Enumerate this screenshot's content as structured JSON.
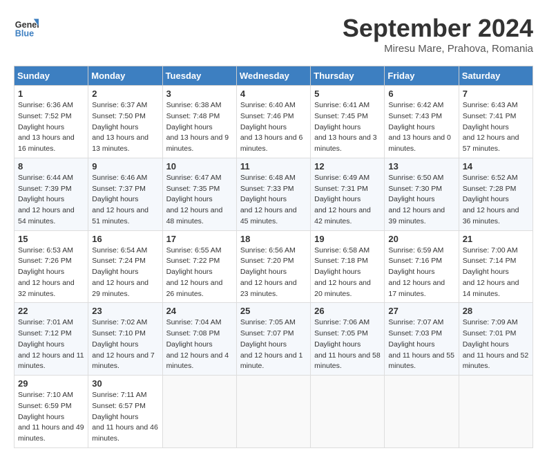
{
  "logo": {
    "line1": "General",
    "line2": "Blue"
  },
  "title": "September 2024",
  "location": "Miresu Mare, Prahova, Romania",
  "days_of_week": [
    "Sunday",
    "Monday",
    "Tuesday",
    "Wednesday",
    "Thursday",
    "Friday",
    "Saturday"
  ],
  "weeks": [
    [
      {
        "day": "1",
        "sunrise": "6:36 AM",
        "sunset": "7:52 PM",
        "daylight": "13 hours and 16 minutes."
      },
      {
        "day": "2",
        "sunrise": "6:37 AM",
        "sunset": "7:50 PM",
        "daylight": "13 hours and 13 minutes."
      },
      {
        "day": "3",
        "sunrise": "6:38 AM",
        "sunset": "7:48 PM",
        "daylight": "13 hours and 9 minutes."
      },
      {
        "day": "4",
        "sunrise": "6:40 AM",
        "sunset": "7:46 PM",
        "daylight": "13 hours and 6 minutes."
      },
      {
        "day": "5",
        "sunrise": "6:41 AM",
        "sunset": "7:45 PM",
        "daylight": "13 hours and 3 minutes."
      },
      {
        "day": "6",
        "sunrise": "6:42 AM",
        "sunset": "7:43 PM",
        "daylight": "13 hours and 0 minutes."
      },
      {
        "day": "7",
        "sunrise": "6:43 AM",
        "sunset": "7:41 PM",
        "daylight": "12 hours and 57 minutes."
      }
    ],
    [
      {
        "day": "8",
        "sunrise": "6:44 AM",
        "sunset": "7:39 PM",
        "daylight": "12 hours and 54 minutes."
      },
      {
        "day": "9",
        "sunrise": "6:46 AM",
        "sunset": "7:37 PM",
        "daylight": "12 hours and 51 minutes."
      },
      {
        "day": "10",
        "sunrise": "6:47 AM",
        "sunset": "7:35 PM",
        "daylight": "12 hours and 48 minutes."
      },
      {
        "day": "11",
        "sunrise": "6:48 AM",
        "sunset": "7:33 PM",
        "daylight": "12 hours and 45 minutes."
      },
      {
        "day": "12",
        "sunrise": "6:49 AM",
        "sunset": "7:31 PM",
        "daylight": "12 hours and 42 minutes."
      },
      {
        "day": "13",
        "sunrise": "6:50 AM",
        "sunset": "7:30 PM",
        "daylight": "12 hours and 39 minutes."
      },
      {
        "day": "14",
        "sunrise": "6:52 AM",
        "sunset": "7:28 PM",
        "daylight": "12 hours and 36 minutes."
      }
    ],
    [
      {
        "day": "15",
        "sunrise": "6:53 AM",
        "sunset": "7:26 PM",
        "daylight": "12 hours and 32 minutes."
      },
      {
        "day": "16",
        "sunrise": "6:54 AM",
        "sunset": "7:24 PM",
        "daylight": "12 hours and 29 minutes."
      },
      {
        "day": "17",
        "sunrise": "6:55 AM",
        "sunset": "7:22 PM",
        "daylight": "12 hours and 26 minutes."
      },
      {
        "day": "18",
        "sunrise": "6:56 AM",
        "sunset": "7:20 PM",
        "daylight": "12 hours and 23 minutes."
      },
      {
        "day": "19",
        "sunrise": "6:58 AM",
        "sunset": "7:18 PM",
        "daylight": "12 hours and 20 minutes."
      },
      {
        "day": "20",
        "sunrise": "6:59 AM",
        "sunset": "7:16 PM",
        "daylight": "12 hours and 17 minutes."
      },
      {
        "day": "21",
        "sunrise": "7:00 AM",
        "sunset": "7:14 PM",
        "daylight": "12 hours and 14 minutes."
      }
    ],
    [
      {
        "day": "22",
        "sunrise": "7:01 AM",
        "sunset": "7:12 PM",
        "daylight": "12 hours and 11 minutes."
      },
      {
        "day": "23",
        "sunrise": "7:02 AM",
        "sunset": "7:10 PM",
        "daylight": "12 hours and 7 minutes."
      },
      {
        "day": "24",
        "sunrise": "7:04 AM",
        "sunset": "7:08 PM",
        "daylight": "12 hours and 4 minutes."
      },
      {
        "day": "25",
        "sunrise": "7:05 AM",
        "sunset": "7:07 PM",
        "daylight": "12 hours and 1 minute."
      },
      {
        "day": "26",
        "sunrise": "7:06 AM",
        "sunset": "7:05 PM",
        "daylight": "11 hours and 58 minutes."
      },
      {
        "day": "27",
        "sunrise": "7:07 AM",
        "sunset": "7:03 PM",
        "daylight": "11 hours and 55 minutes."
      },
      {
        "day": "28",
        "sunrise": "7:09 AM",
        "sunset": "7:01 PM",
        "daylight": "11 hours and 52 minutes."
      }
    ],
    [
      {
        "day": "29",
        "sunrise": "7:10 AM",
        "sunset": "6:59 PM",
        "daylight": "11 hours and 49 minutes."
      },
      {
        "day": "30",
        "sunrise": "7:11 AM",
        "sunset": "6:57 PM",
        "daylight": "11 hours and 46 minutes."
      },
      null,
      null,
      null,
      null,
      null
    ]
  ]
}
